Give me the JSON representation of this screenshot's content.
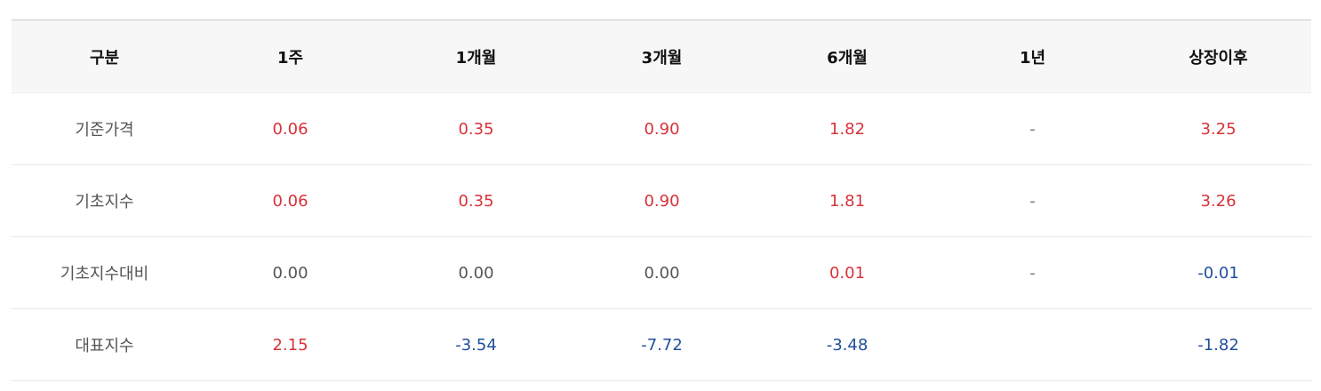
{
  "table": {
    "headers": [
      "구분",
      "1주",
      "1개월",
      "3개월",
      "6개월",
      "1년",
      "상장이후"
    ],
    "rows": [
      {
        "label": "기준가격",
        "cells": [
          {
            "v": "0.06",
            "tone": "pos"
          },
          {
            "v": "0.35",
            "tone": "pos"
          },
          {
            "v": "0.90",
            "tone": "pos"
          },
          {
            "v": "1.82",
            "tone": "pos"
          },
          {
            "v": "-",
            "tone": "dash"
          },
          {
            "v": "3.25",
            "tone": "pos"
          }
        ]
      },
      {
        "label": "기초지수",
        "cells": [
          {
            "v": "0.06",
            "tone": "pos"
          },
          {
            "v": "0.35",
            "tone": "pos"
          },
          {
            "v": "0.90",
            "tone": "pos"
          },
          {
            "v": "1.81",
            "tone": "pos"
          },
          {
            "v": "-",
            "tone": "dash"
          },
          {
            "v": "3.26",
            "tone": "pos"
          }
        ]
      },
      {
        "label": "기초지수대비",
        "cells": [
          {
            "v": "0.00",
            "tone": "zero"
          },
          {
            "v": "0.00",
            "tone": "zero"
          },
          {
            "v": "0.00",
            "tone": "zero"
          },
          {
            "v": "0.01",
            "tone": "pos"
          },
          {
            "v": "-",
            "tone": "dash"
          },
          {
            "v": "-0.01",
            "tone": "neg"
          }
        ]
      },
      {
        "label": "대표지수",
        "cells": [
          {
            "v": "2.15",
            "tone": "pos"
          },
          {
            "v": "-3.54",
            "tone": "neg"
          },
          {
            "v": "-7.72",
            "tone": "neg"
          },
          {
            "v": "-3.48",
            "tone": "neg"
          },
          {
            "v": "",
            "tone": "dash"
          },
          {
            "v": "-1.82",
            "tone": "neg"
          }
        ]
      }
    ]
  },
  "colors": {
    "positive": "#d7323a",
    "negative": "#1f4f9c",
    "neutral": "#555555",
    "header_bg": "#f7f7f7"
  }
}
